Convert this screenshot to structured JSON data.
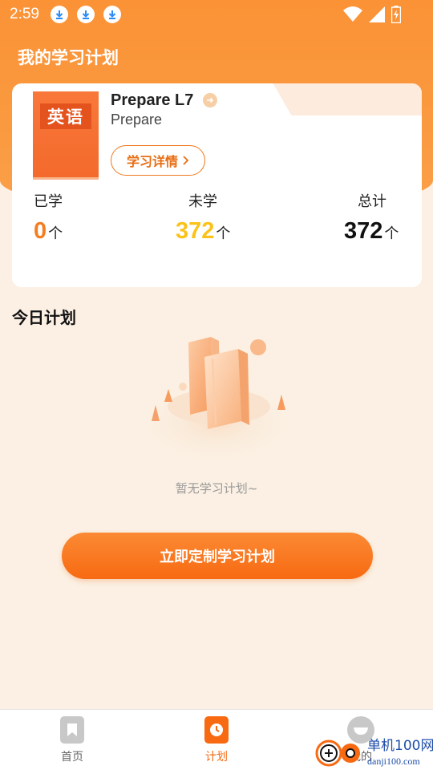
{
  "status": {
    "time": "2:59",
    "download_icons": [
      "download-icon",
      "download-icon",
      "download-icon"
    ],
    "right_icons": [
      "wifi-icon",
      "signal-icon",
      "battery-icon"
    ]
  },
  "page": {
    "title": "我的学习计划"
  },
  "book": {
    "cover_label": "英语",
    "title": "Prepare L7",
    "subtitle": "Prepare",
    "detail_button": "学习详情"
  },
  "stats": {
    "learned": {
      "label": "已学",
      "value": "0",
      "unit": "个"
    },
    "unlearned": {
      "label": "未学",
      "value": "372",
      "unit": "个"
    },
    "total": {
      "label": "总计",
      "value": "372",
      "unit": "个"
    }
  },
  "today": {
    "title": "今日计划",
    "empty_text": "暂无学习计划~",
    "cta_label": "立即定制学习计划"
  },
  "tabbar": {
    "tabs": [
      {
        "label": "首页",
        "icon": "bookmark-icon",
        "active": false
      },
      {
        "label": "计划",
        "icon": "clock-icon",
        "active": true
      },
      {
        "label": "我的",
        "icon": "profile-icon",
        "active": false
      }
    ]
  },
  "watermark": {
    "site": "单机100网",
    "url": "danji100.com"
  },
  "colors": {
    "accent": "#F76A12",
    "header": "#FB9236",
    "learned": "#F57C1F",
    "unlearned": "#FBC21A",
    "background": "#FBF0E3"
  }
}
